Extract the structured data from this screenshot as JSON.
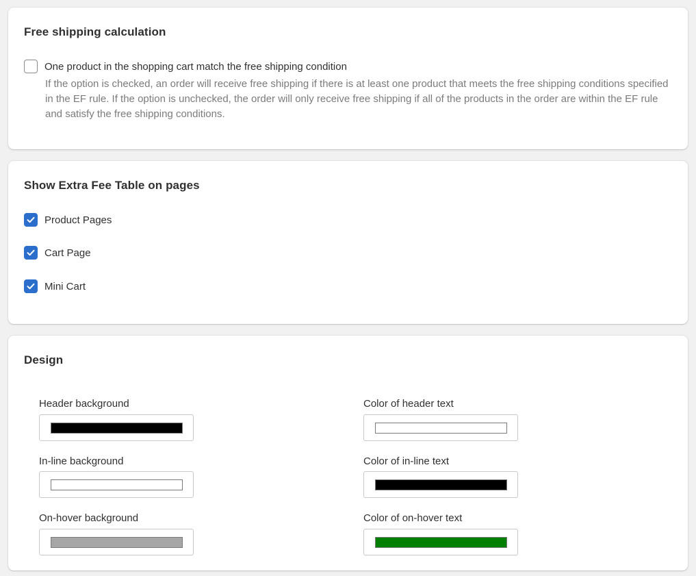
{
  "free_shipping": {
    "title": "Free shipping calculation",
    "option_label": "One product in the shopping cart match the free shipping condition",
    "option_checked": false,
    "help_text": "If the option is checked, an order will receive free shipping if there is at least one product that meets the free shipping conditions specified in the EF rule. If the option is unchecked, the order will only receive free shipping if all of the products in the order are within the EF rule and satisfy the free shipping conditions."
  },
  "extra_fee_table": {
    "title": "Show Extra Fee Table on pages",
    "options": [
      {
        "label": "Product Pages",
        "checked": true
      },
      {
        "label": "Cart Page",
        "checked": true
      },
      {
        "label": "Mini Cart",
        "checked": true
      }
    ]
  },
  "design": {
    "title": "Design",
    "fields": [
      {
        "label": "Header background",
        "color": "#000000"
      },
      {
        "label": "Color of header text",
        "color": "#ffffff"
      },
      {
        "label": "In-line background",
        "color": "#ffffff"
      },
      {
        "label": "Color of in-line text",
        "color": "#000000"
      },
      {
        "label": "On-hover background",
        "color": "#a6a6a6"
      },
      {
        "label": "Color of on-hover text",
        "color": "#008000"
      }
    ]
  },
  "colors": {
    "checkbox_checked": "#2c6ecb",
    "help_text": "#7b7b7b"
  }
}
